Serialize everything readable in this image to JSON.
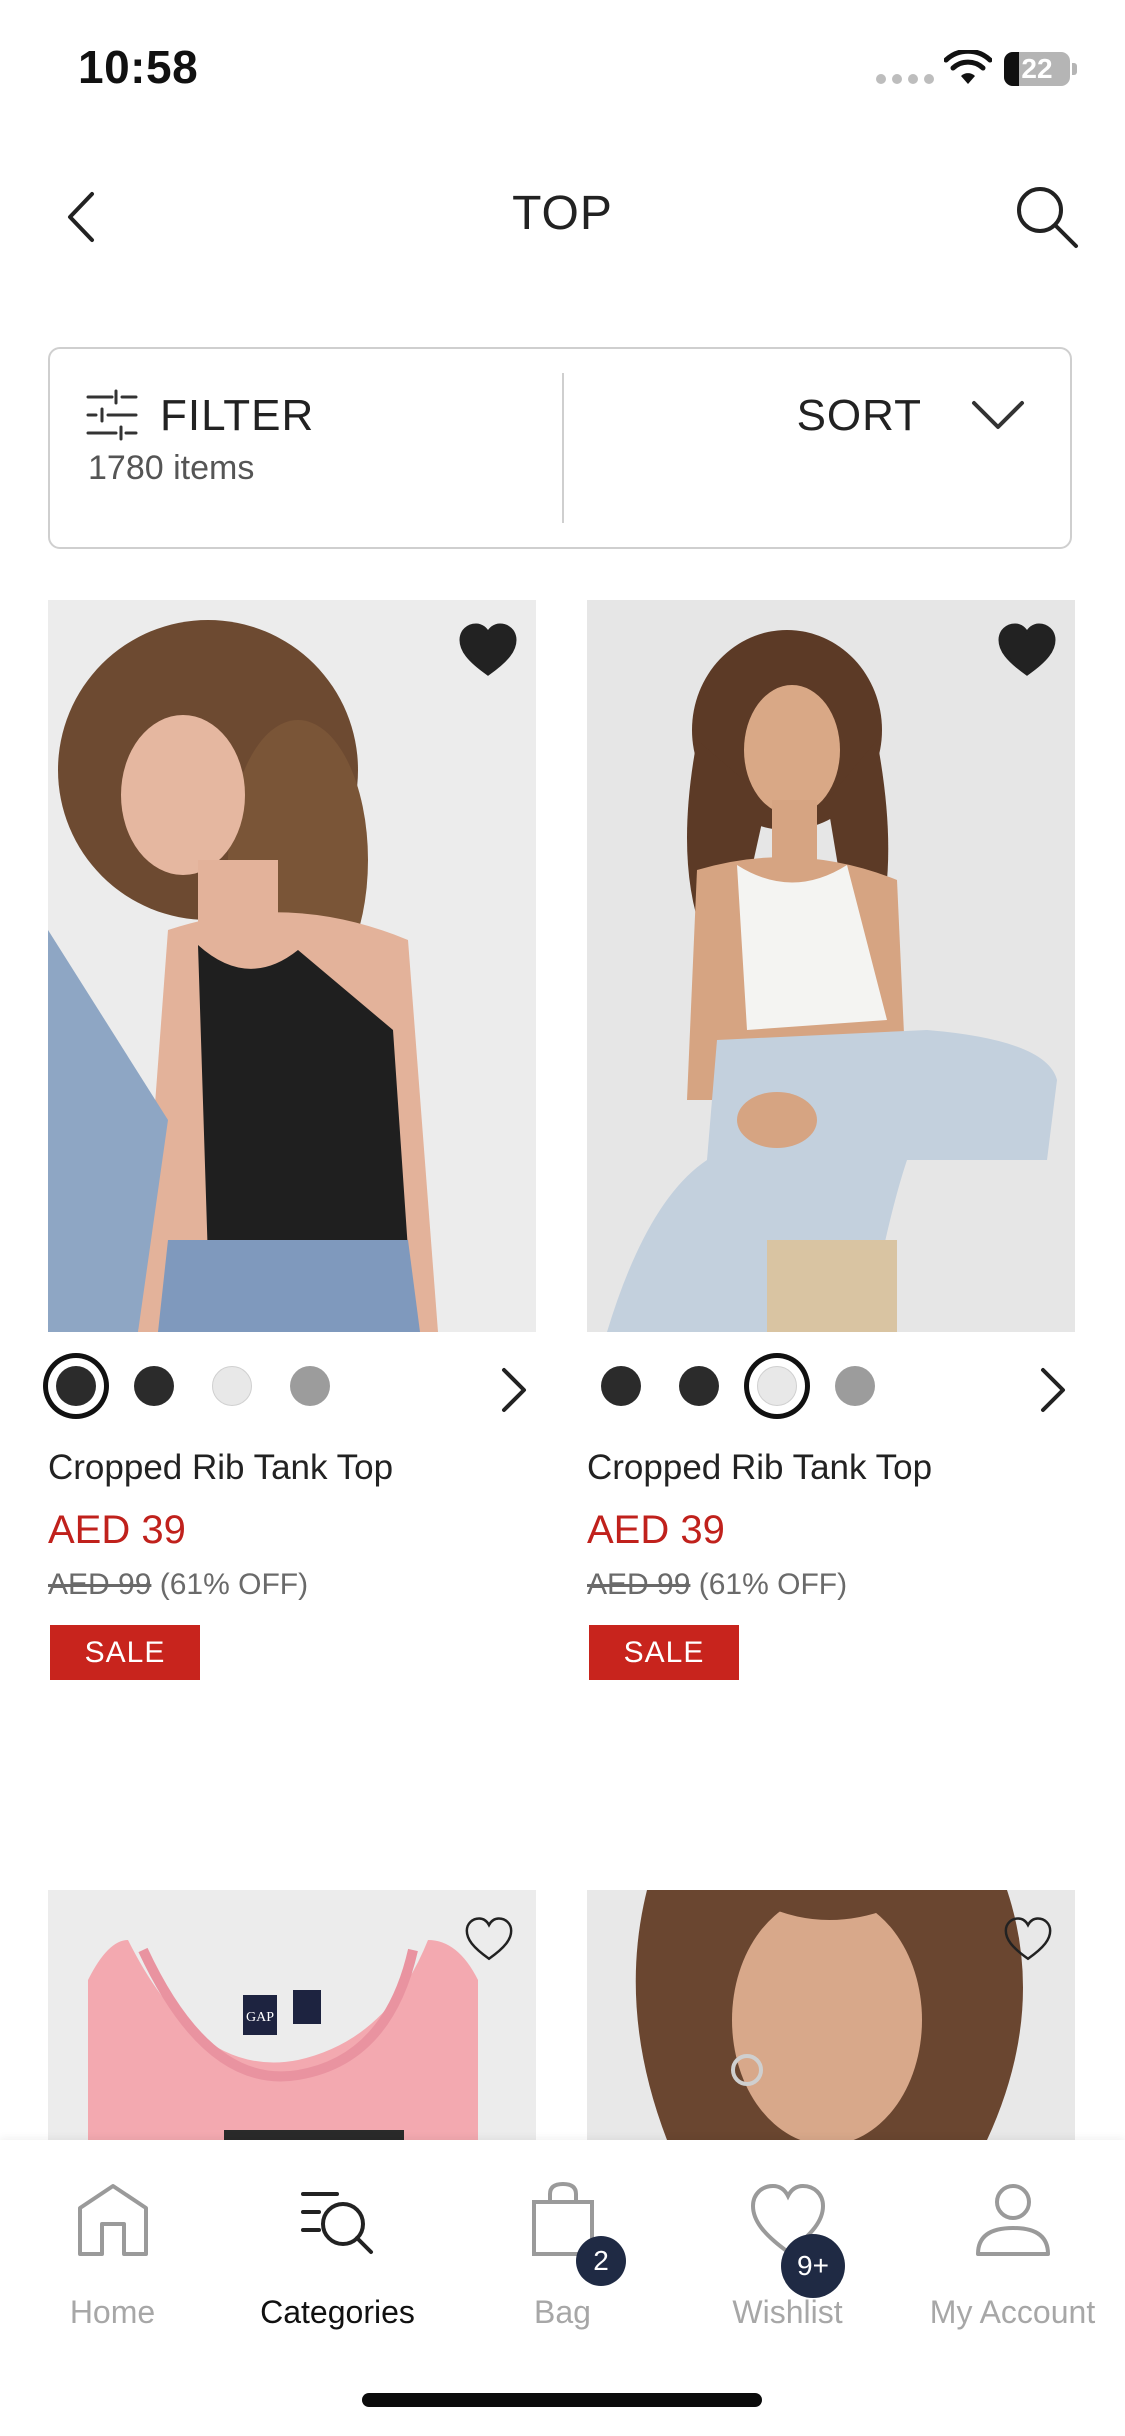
{
  "status_bar": {
    "time": "10:58",
    "battery": "22",
    "battery_level": 0.22
  },
  "header": {
    "title": "TOP"
  },
  "filter_bar": {
    "filter_label": "FILTER",
    "item_count": "1780 items",
    "sort_label": "SORT"
  },
  "products": [
    {
      "name": "Cropped Rib Tank Top",
      "price": "AED 39",
      "original_price": "AED 99",
      "discount": "(61% OFF)",
      "badge": "SALE",
      "wishlisted": true,
      "swatches": [
        {
          "color": "#2b2b2b",
          "selected": true
        },
        {
          "color": "#2b2b2b",
          "selected": false
        },
        {
          "color": "#e8e8e8",
          "selected": false
        },
        {
          "color": "#9c9c9c",
          "selected": false
        }
      ]
    },
    {
      "name": "Cropped Rib Tank Top",
      "price": "AED 39",
      "original_price": "AED 99",
      "discount": "(61% OFF)",
      "badge": "SALE",
      "wishlisted": true,
      "swatches": [
        {
          "color": "#2b2b2b",
          "selected": false
        },
        {
          "color": "#2b2b2b",
          "selected": false
        },
        {
          "color": "#e8e8e8",
          "selected": true
        },
        {
          "color": "#9c9c9c",
          "selected": false
        }
      ]
    },
    {
      "wishlisted": false
    },
    {
      "wishlisted": false
    }
  ],
  "bottom_nav": {
    "items": [
      {
        "label": "Home",
        "icon": "home-icon",
        "active": false
      },
      {
        "label": "Categories",
        "icon": "categories-icon",
        "active": true
      },
      {
        "label": "Bag",
        "icon": "bag-icon",
        "active": false,
        "badge": "2"
      },
      {
        "label": "Wishlist",
        "icon": "heart-icon",
        "active": false,
        "badge": "9+"
      },
      {
        "label": "My Account",
        "icon": "account-icon",
        "active": false
      }
    ]
  },
  "colors": {
    "sale_red": "#c8241d",
    "price_red": "#c0211c",
    "badge_navy": "#1f2a44"
  }
}
